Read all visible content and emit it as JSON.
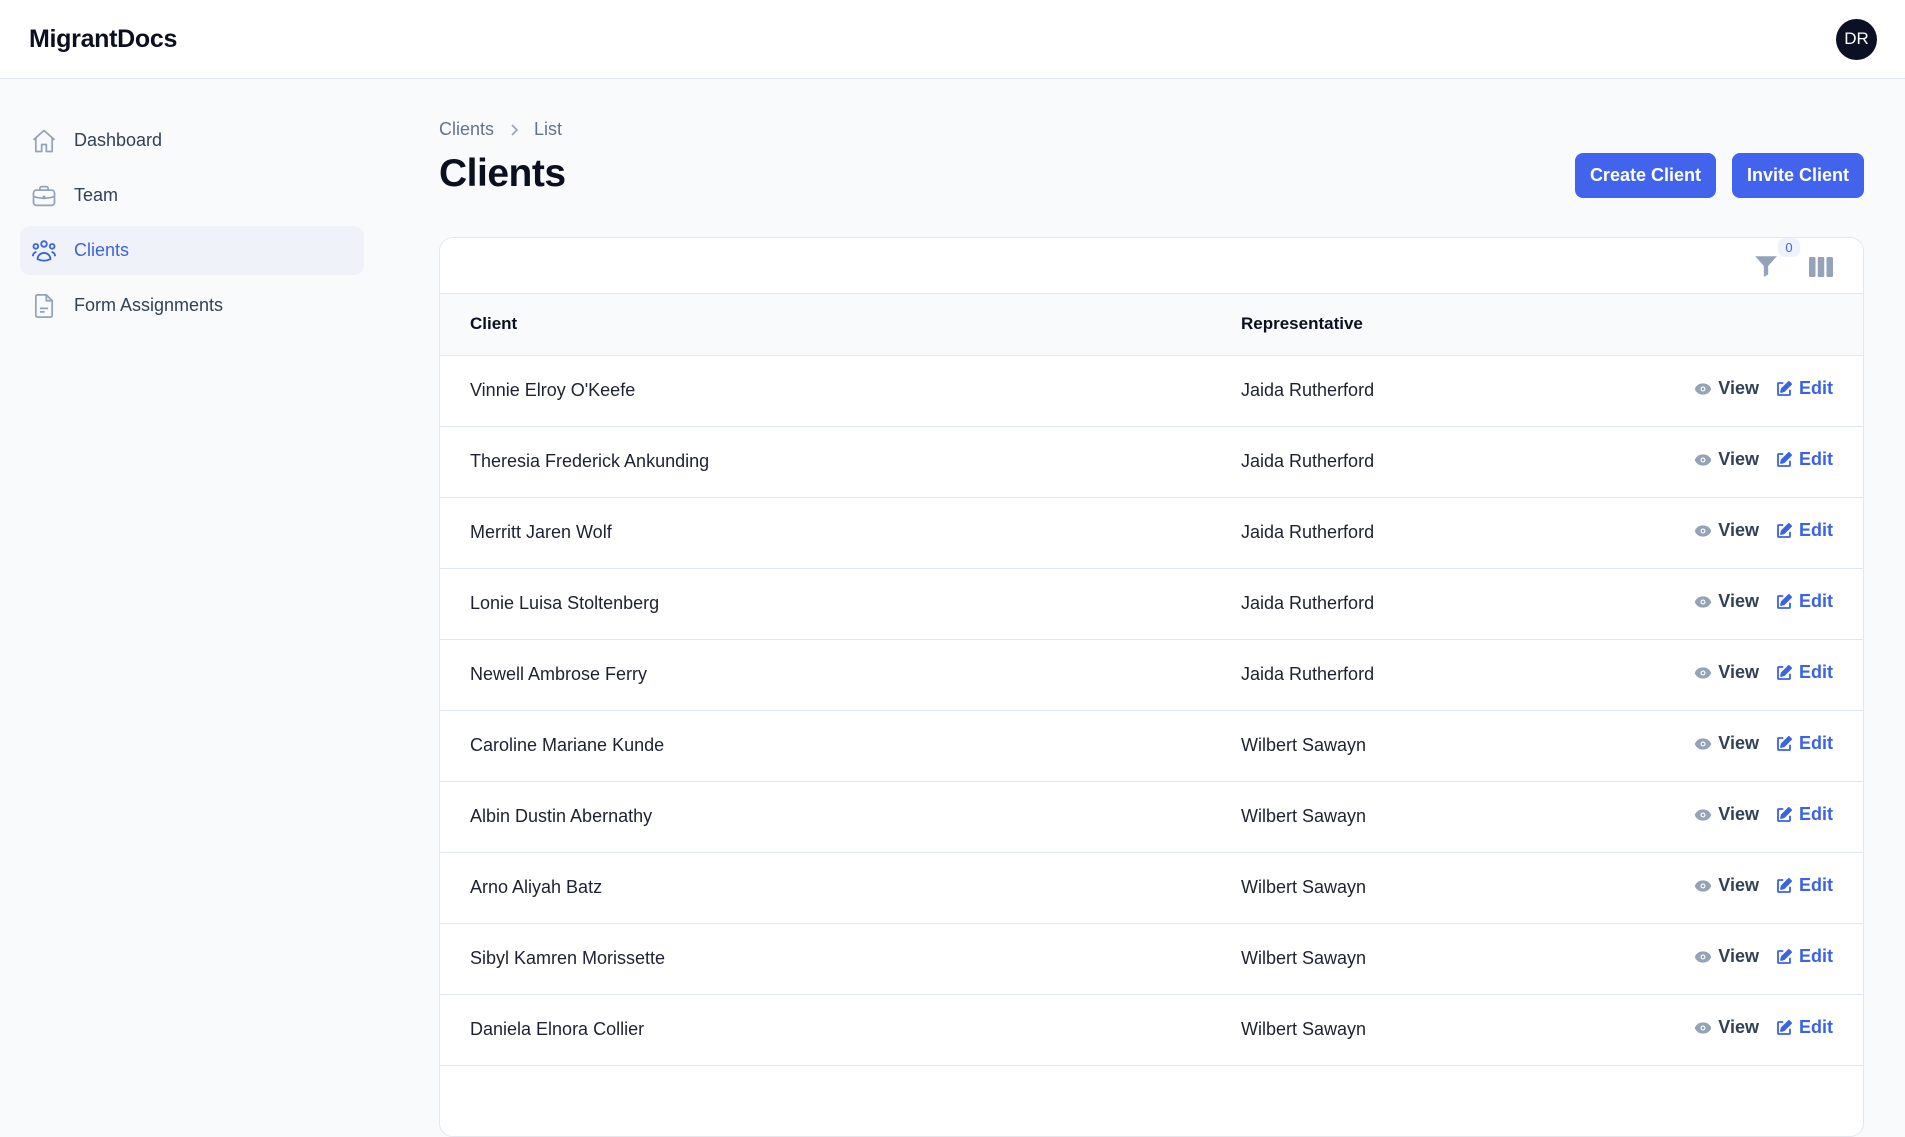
{
  "app": {
    "brand": "MigrantDocs",
    "user_initials": "DR"
  },
  "colors": {
    "accent": "#4263eb",
    "active_nav_bg": "#eff3f9",
    "page_bg": "#f8fafc",
    "avatar_bg": "#0b1024"
  },
  "sidebar": {
    "items": [
      {
        "label": "Dashboard",
        "icon": "home-icon",
        "active": false
      },
      {
        "label": "Team",
        "icon": "briefcase-icon",
        "active": false
      },
      {
        "label": "Clients",
        "icon": "users-icon",
        "active": true
      },
      {
        "label": "Form Assignments",
        "icon": "document-icon",
        "active": false
      }
    ]
  },
  "breadcrumb": {
    "items": [
      "Clients",
      "List"
    ]
  },
  "page": {
    "title": "Clients",
    "create_button": "Create Client",
    "invite_button": "Invite Client"
  },
  "table": {
    "filter_count": "0",
    "headers": {
      "client": "Client",
      "representative": "Representative"
    },
    "view_label": "View",
    "edit_label": "Edit",
    "rows": [
      {
        "client": "Vinnie Elroy O'Keefe",
        "representative": "Jaida Rutherford"
      },
      {
        "client": "Theresia Frederick Ankunding",
        "representative": "Jaida Rutherford"
      },
      {
        "client": "Merritt Jaren Wolf",
        "representative": "Jaida Rutherford"
      },
      {
        "client": "Lonie Luisa Stoltenberg",
        "representative": "Jaida Rutherford"
      },
      {
        "client": "Newell Ambrose Ferry",
        "representative": "Jaida Rutherford"
      },
      {
        "client": "Caroline Mariane Kunde",
        "representative": "Wilbert Sawayn"
      },
      {
        "client": "Albin Dustin Abernathy",
        "representative": "Wilbert Sawayn"
      },
      {
        "client": "Arno Aliyah Batz",
        "representative": "Wilbert Sawayn"
      },
      {
        "client": "Sibyl Kamren Morissette",
        "representative": "Wilbert Sawayn"
      },
      {
        "client": "Daniela Elnora Collier",
        "representative": "Wilbert Sawayn"
      }
    ]
  }
}
